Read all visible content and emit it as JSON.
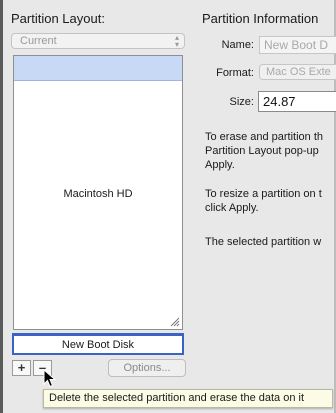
{
  "left_pane": {
    "heading": "Partition Layout:",
    "layout_popup": {
      "value": "Current",
      "arrows": "▴▾"
    },
    "partitions": [
      {
        "name": "Macintosh HD"
      },
      {
        "name": "New Boot Disk"
      }
    ],
    "add_button": "+",
    "remove_button": "–",
    "options_button": "Options..."
  },
  "right_pane": {
    "heading": "Partition Information",
    "name_label": "Name:",
    "name_value": "New Boot D",
    "format_label": "Format:",
    "format_value": "Mac OS Exte",
    "size_label": "Size:",
    "size_value": "24.87",
    "info_text_1": "To erase and partition th\nPartition Layout pop-up\nApply.",
    "info_text_2": "To resize a partition on t\nclick Apply.",
    "info_text_3": "The selected partition w"
  },
  "tooltip": {
    "text": "Delete the selected partition and erase the data on it"
  },
  "colors": {
    "selection": "#c8d9f5",
    "focus_ring": "#3a63c4",
    "tooltip_bg": "#fbfbe6"
  }
}
